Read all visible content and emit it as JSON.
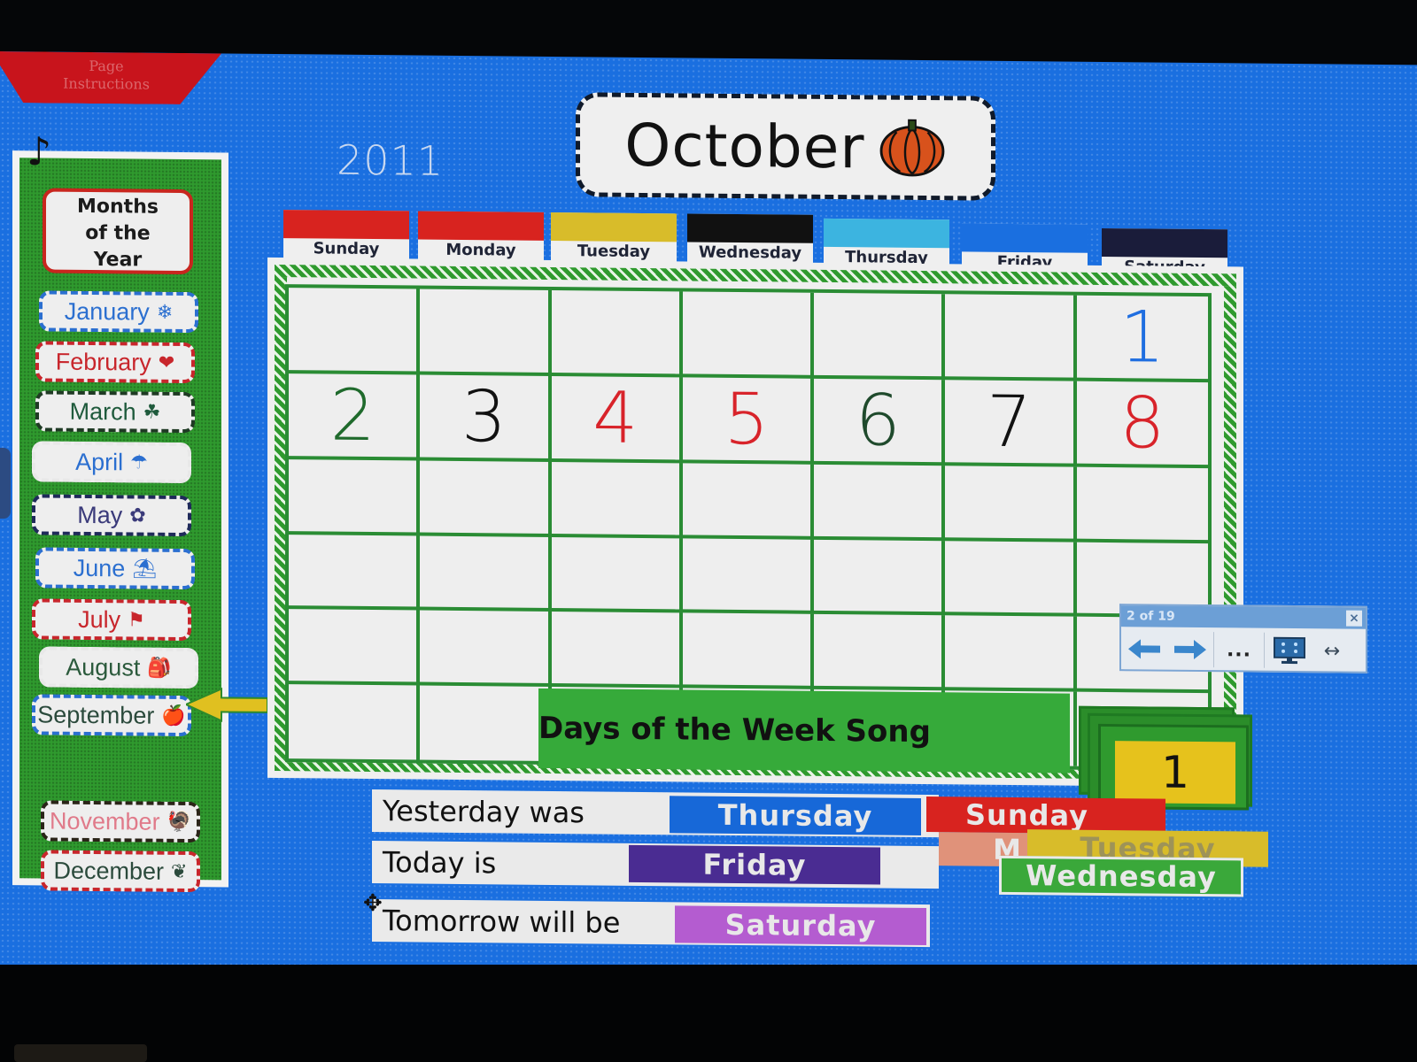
{
  "page_instructions": {
    "line1": "Page",
    "line2": "Instructions"
  },
  "music_icon": "music-note-icon",
  "months_panel": {
    "title_lines": [
      "Months",
      "of the",
      "Year"
    ],
    "items": [
      {
        "label": "January",
        "icon": "❄",
        "icon_name": "snowflake-icon",
        "text_color": "#2b6fd0",
        "border_color": "#2b6fd0"
      },
      {
        "label": "February",
        "icon": "❤",
        "icon_name": "heart-icon",
        "text_color": "#c8262c",
        "border_color": "#c8262c"
      },
      {
        "label": "March",
        "icon": "☘",
        "icon_name": "shamrock-icon",
        "text_color": "#1f5a3c",
        "border_color": "#1f3a24"
      },
      {
        "label": "April",
        "icon": "☂",
        "icon_name": "umbrella-icon",
        "text_color": "#2b6fd0",
        "border_color": "#e8e8e8"
      },
      {
        "label": "May",
        "icon": "✿",
        "icon_name": "flower-icon",
        "text_color": "#3a3a7a",
        "border_color": "#1f2a5a"
      },
      {
        "label": "June",
        "icon": "⛱",
        "icon_name": "beach-pail-icon",
        "text_color": "#2b6fd0",
        "border_color": "#2b6fd0"
      },
      {
        "label": "July",
        "icon": "⚑",
        "icon_name": "us-flag-icon",
        "text_color": "#c8262c",
        "border_color": "#c8262c"
      },
      {
        "label": "August",
        "icon": "🎒",
        "icon_name": "backpack-icon",
        "text_color": "#2b5a3c",
        "border_color": "#e8e8e8"
      },
      {
        "label": "September",
        "icon": "🍎",
        "icon_name": "apple-icon",
        "text_color": "#2b4a3c",
        "border_color": "#2b6fd0"
      },
      {
        "label": "November",
        "icon": "🦃",
        "icon_name": "turkey-icon",
        "text_color": "#e07a8a",
        "border_color": "#2a2418"
      },
      {
        "label": "December",
        "icon": "❦",
        "icon_name": "holly-icon",
        "text_color": "#2b4a3c",
        "border_color": "#c8262c"
      }
    ],
    "selected_month": "September"
  },
  "year": "2011",
  "month_title": {
    "label": "October",
    "icon_name": "pumpkin-icon"
  },
  "weekdays": [
    {
      "label": "Sunday",
      "color": "#d8231f"
    },
    {
      "label": "Monday",
      "color": "#d8231f"
    },
    {
      "label": "Tuesday",
      "color": "#d8bc2a"
    },
    {
      "label": "Wednesday",
      "color": "#111111"
    },
    {
      "label": "Thursday",
      "color": "#3cb4e0"
    },
    {
      "label": "Friday",
      "color": "#1a6fe0"
    },
    {
      "label": "Saturday",
      "color": "#1a1c3a"
    }
  ],
  "calendar": {
    "cells": [
      {
        "v": "",
        "c": ""
      },
      {
        "v": "",
        "c": ""
      },
      {
        "v": "",
        "c": ""
      },
      {
        "v": "",
        "c": ""
      },
      {
        "v": "",
        "c": ""
      },
      {
        "v": "",
        "c": ""
      },
      {
        "v": "1",
        "c": "#1f6ee0"
      },
      {
        "v": "2",
        "c": "#1f6a2c"
      },
      {
        "v": "3",
        "c": "#111111"
      },
      {
        "v": "4",
        "c": "#d8232a"
      },
      {
        "v": "5",
        "c": "#d8232a"
      },
      {
        "v": "6",
        "c": "#1f4a2c"
      },
      {
        "v": "7",
        "c": "#111111"
      },
      {
        "v": "8",
        "c": "#d8232a"
      },
      {
        "v": "",
        "c": ""
      },
      {
        "v": "",
        "c": ""
      },
      {
        "v": "",
        "c": ""
      },
      {
        "v": "",
        "c": ""
      },
      {
        "v": "",
        "c": ""
      },
      {
        "v": "",
        "c": ""
      },
      {
        "v": "",
        "c": ""
      },
      {
        "v": "",
        "c": ""
      },
      {
        "v": "",
        "c": ""
      },
      {
        "v": "",
        "c": ""
      },
      {
        "v": "",
        "c": ""
      },
      {
        "v": "",
        "c": ""
      },
      {
        "v": "",
        "c": ""
      },
      {
        "v": "",
        "c": ""
      },
      {
        "v": "",
        "c": ""
      },
      {
        "v": "",
        "c": ""
      },
      {
        "v": "",
        "c": ""
      },
      {
        "v": "",
        "c": ""
      },
      {
        "v": "",
        "c": ""
      },
      {
        "v": "",
        "c": ""
      },
      {
        "v": "",
        "c": ""
      },
      {
        "v": "",
        "c": ""
      },
      {
        "v": "",
        "c": ""
      },
      {
        "v": "",
        "c": ""
      },
      {
        "v": "",
        "c": ""
      },
      {
        "v": "",
        "c": ""
      },
      {
        "v": "",
        "c": ""
      },
      {
        "v": "",
        "c": ""
      }
    ]
  },
  "song_banner": "Days of the Week Song",
  "day_counter": "1",
  "navigator": {
    "page_indicator": "2 of 19",
    "close_icon": "×",
    "prev_icon": "arrow-left-icon",
    "next_icon": "arrow-right-icon",
    "more_label": "...",
    "fullscreen_icon": "monitor-icon",
    "resize_icon": "↔"
  },
  "ytt": {
    "yesterday_label": "Yesterday was",
    "yesterday_value": "Thursday",
    "yesterday_color": "#1768d8",
    "today_label": "Today is",
    "today_value": "Friday",
    "today_color": "#4a2c92",
    "tomorrow_label": "Tomorrow will be",
    "tomorrow_value": "Saturday",
    "tomorrow_color": "#b45cd0"
  },
  "loose_day_cards": [
    {
      "label": "Sunday",
      "color": "#d8231f"
    },
    {
      "label": "Monday",
      "short": "M",
      "color": "#e0927a"
    },
    {
      "label": "Tuesday",
      "color": "#d8bc2a"
    },
    {
      "label": "Wednesday",
      "color": "#3aa83a"
    }
  ]
}
